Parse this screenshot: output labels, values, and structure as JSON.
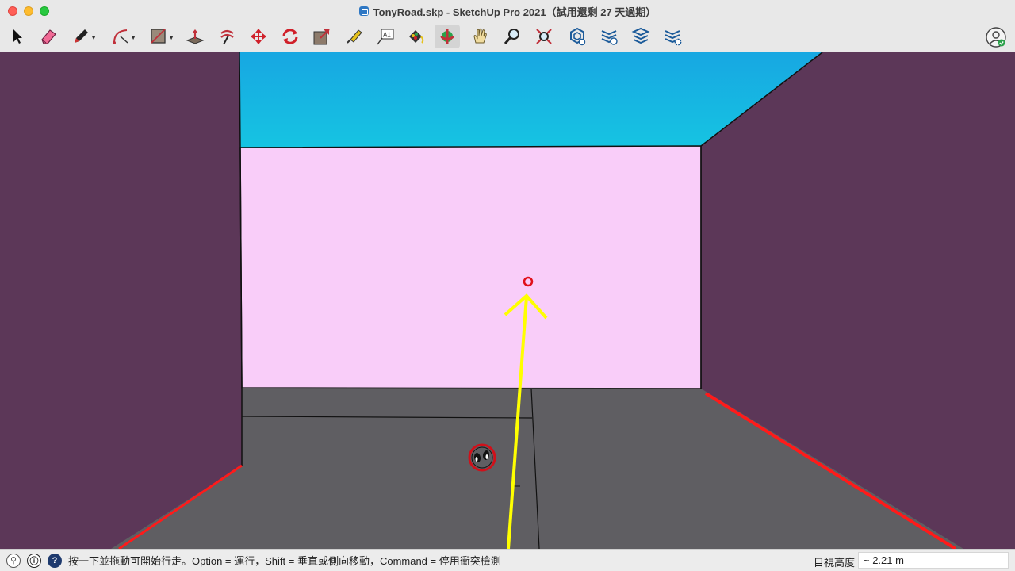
{
  "window": {
    "title": "TonyRoad.skp - SketchUp Pro 2021（試用還剩 27 天過期）"
  },
  "toolbar": {
    "tools": [
      {
        "name": "select-icon"
      },
      {
        "name": "eraser-icon"
      },
      {
        "name": "pencil-line-icon"
      },
      {
        "name": "arc-icon"
      },
      {
        "name": "rectangle-shape-icon"
      },
      {
        "name": "push-pull-icon"
      },
      {
        "name": "offset-icon"
      },
      {
        "name": "move-icon"
      },
      {
        "name": "rotate-icon"
      },
      {
        "name": "scale-icon"
      },
      {
        "name": "tape-measure-icon"
      },
      {
        "name": "text-icon",
        "label": "A1"
      },
      {
        "name": "paint-bucket-icon"
      },
      {
        "name": "orbit-icon",
        "active": true
      },
      {
        "name": "pan-hand-icon"
      },
      {
        "name": "zoom-icon"
      },
      {
        "name": "zoom-extents-icon"
      },
      {
        "name": "warehouse-icon"
      },
      {
        "name": "extension-warehouse-icon"
      },
      {
        "name": "layout-send-icon"
      },
      {
        "name": "extension-manager-icon"
      }
    ],
    "user": {
      "name": "account-icon"
    }
  },
  "status": {
    "text": "按一下並拖動可開始行走。Option = 運行，Shift = 垂直或側向移動，Command = 停用衝突檢測",
    "eye_height_label": "目視高度",
    "eye_height_value": "~ 2.21 m"
  },
  "colors": {
    "sky": "#1bb4e0",
    "back_wall": "#f9cdf9",
    "side_walls": "#5c3758",
    "floor": "#5f5e62",
    "edge_red": "#ff1a1a",
    "walk_arrow": "#ffff00"
  }
}
